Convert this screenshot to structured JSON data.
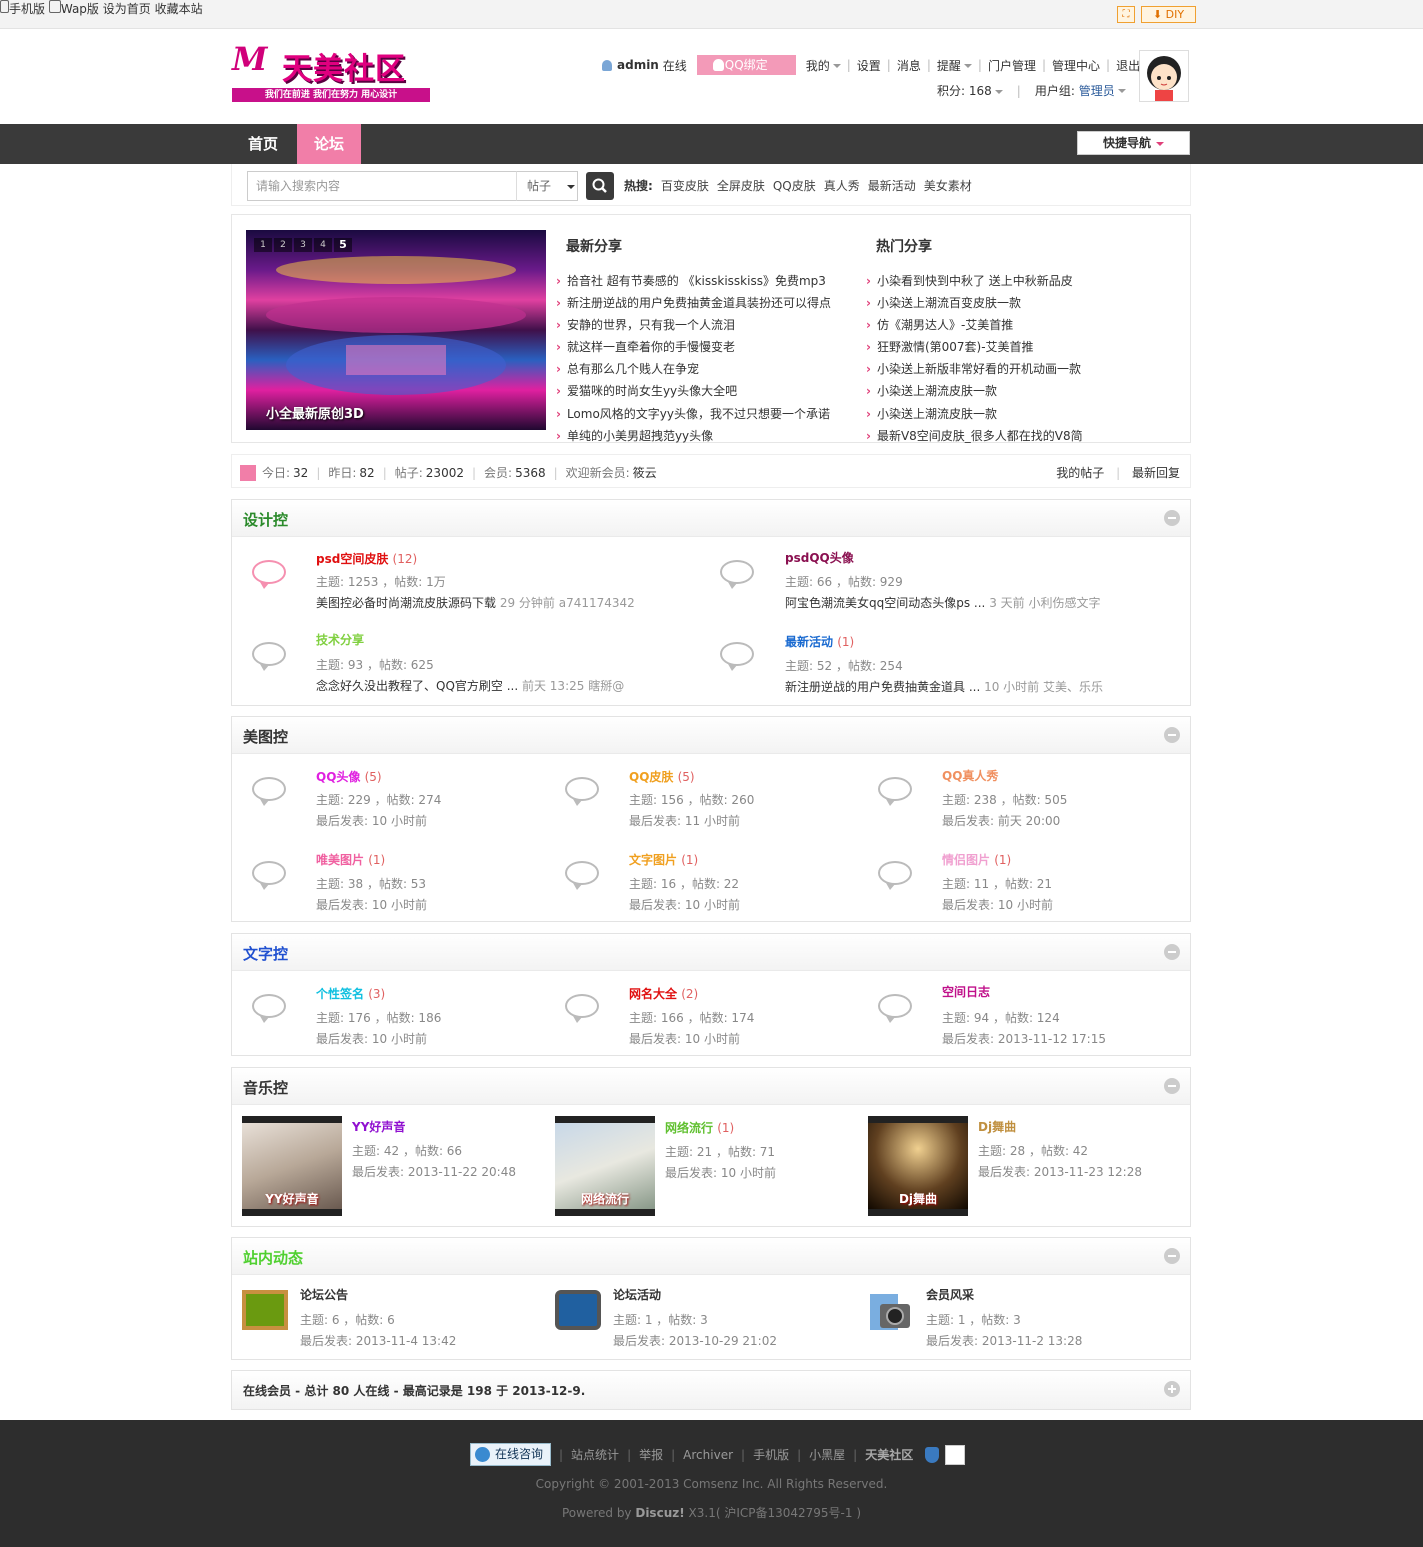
{
  "topbar": {
    "mobile": "手机版",
    "wap": "Wap版",
    "set_home": "设为首页",
    "bookmark": "收藏本站",
    "diy": "DIY"
  },
  "logo": {
    "name": "天美社区",
    "slogan": "我们在前进 我们在努力 用心设计"
  },
  "user": {
    "name": "admin",
    "status": "在线",
    "qq_bind": "QQ绑定",
    "my": "我的",
    "settings": "设置",
    "messages": "消息",
    "remind": "提醒",
    "portal": "门户管理",
    "admin_center": "管理中心",
    "logout": "退出",
    "points_label": "积分: 168",
    "group_label": "用户组:",
    "group": "管理员"
  },
  "nav": {
    "home": "首页",
    "forum": "论坛",
    "quick": "快捷导航"
  },
  "search": {
    "placeholder": "请输入搜索内容",
    "type": "帖子",
    "hot_label": "热搜:",
    "hot": [
      "百变皮肤",
      "全屏皮肤",
      "QQ皮肤",
      "真人秀",
      "最新活动",
      "美女素材"
    ]
  },
  "slide": {
    "nums": [
      "1",
      "2",
      "3",
      "4",
      "5"
    ],
    "caption": "小全最新原创3D"
  },
  "latest": {
    "title": "最新分享",
    "items": [
      "拾音社 超有节奏感的 《kisskisskiss》免费mp3",
      "新注册逆战的用户免费抽黄金道具装扮还可以得点",
      "安静的世界，只有我一个人流泪",
      "就这样一直牵着你的手慢慢变老",
      "总有那么几个贱人在争宠",
      "爱猫咪的时尚女生yy头像大全吧",
      "Lomo风格的文字yy头像，我不过只想要一个承诺",
      "单纯的小美男超拽范yy头像"
    ]
  },
  "hotshare": {
    "title": "热门分享",
    "items": [
      "小染看到快到中秋了 送上中秋新品皮",
      "小染送上潮流百变皮肤一款",
      "仿《潮男达人》-艾美首推",
      "狂野激情(第007套)-艾美首推",
      "小染送上新版非常好看的开机动画一款",
      "小染送上潮流皮肤一款",
      "小染送上潮流皮肤一款",
      "最新V8空间皮肤_很多人都在找的V8简"
    ]
  },
  "stats": {
    "today_l": "今日:",
    "today": "32",
    "yest_l": "昨日:",
    "yest": "82",
    "posts_l": "帖子:",
    "posts": "23002",
    "members_l": "会员:",
    "members": "5368",
    "welcome_l": "欢迎新会员:",
    "welcome": "筱云",
    "my_posts": "我的帖子",
    "latest_reply": "最新回复"
  },
  "sections": {
    "design": {
      "title": "设计控",
      "forums": [
        {
          "name": "psd空间皮肤",
          "count": "(12)",
          "meta": "主题: 1253 ，帖数: 1万",
          "last": "美图控必备时尚潮流皮肤源码下载",
          "when": "29 分钟前 a741174342"
        },
        {
          "name": "psdQQ头像",
          "count": "",
          "meta": "主题: 66 ，帖数: 929",
          "last": "阿宝色潮流美女qq空间动态头像ps ...",
          "when": "3 天前 小利伤感文字"
        },
        {
          "name": "技术分享",
          "count": "",
          "meta": "主题: 93 ，帖数: 625",
          "last": "念念好久没出教程了、QQ官方刷空 ...",
          "when": "前天 13:25 瞎掰@"
        },
        {
          "name": "最新活动",
          "count": "(1)",
          "meta": "主题: 52 ，帖数: 254",
          "last": "新注册逆战的用户免费抽黄金道具 ...",
          "when": "10 小时前 艾美、乐乐"
        }
      ]
    },
    "pic": {
      "title": "美图控",
      "forums": [
        {
          "name": "QQ头像",
          "count": "(5)",
          "meta": "主题: 229 ，帖数: 274",
          "last": "最后发表: 10 小时前"
        },
        {
          "name": "QQ皮肤",
          "count": "(5)",
          "meta": "主题: 156 ，帖数: 260",
          "last": "最后发表: 11 小时前"
        },
        {
          "name": "QQ真人秀",
          "count": "",
          "meta": "主题: 238 ，帖数: 505",
          "last": "最后发表: 前天 20:00"
        },
        {
          "name": "唯美图片",
          "count": "(1)",
          "meta": "主题: 38 ，帖数: 53",
          "last": "最后发表: 10 小时前"
        },
        {
          "name": "文字图片",
          "count": "(1)",
          "meta": "主题: 16 ，帖数: 22",
          "last": "最后发表: 10 小时前"
        },
        {
          "name": "情侣图片",
          "count": "(1)",
          "meta": "主题: 11 ，帖数: 21",
          "last": "最后发表: 10 小时前"
        }
      ]
    },
    "text": {
      "title": "文字控",
      "forums": [
        {
          "name": "个性签名",
          "count": "(3)",
          "meta": "主题: 176 ，帖数: 186",
          "last": "最后发表: 10 小时前"
        },
        {
          "name": "网名大全",
          "count": "(2)",
          "meta": "主题: 166 ，帖数: 174",
          "last": "最后发表: 10 小时前"
        },
        {
          "name": "空间日志",
          "count": "",
          "meta": "主题: 94 ，帖数: 124",
          "last": "最后发表: 2013-11-12 17:15"
        }
      ]
    },
    "music": {
      "title": "音乐控",
      "forums": [
        {
          "name": "YY好声音",
          "count": "",
          "meta": "主题: 42 ，帖数: 66",
          "last": "最后发表: 2013-11-22 20:48",
          "thumb": "YY好声音"
        },
        {
          "name": "网络流行",
          "count": "(1)",
          "meta": "主题: 21 ，帖数: 71",
          "last": "最后发表: 10 小时前",
          "thumb": "网络流行"
        },
        {
          "name": "Dj舞曲",
          "count": "",
          "meta": "主题: 28 ，帖数: 42",
          "last": "最后发表: 2013-11-23 12:28",
          "thumb": "Dj舞曲"
        }
      ]
    },
    "site": {
      "title": "站内动态",
      "forums": [
        {
          "name": "论坛公告",
          "meta": "主题: 6 ，帖数: 6",
          "last": "最后发表: 2013-11-4 13:42"
        },
        {
          "name": "论坛活动",
          "meta": "主题: 1 ，帖数: 3",
          "last": "最后发表: 2013-10-29 21:02"
        },
        {
          "name": "会员风采",
          "meta": "主题: 1 ，帖数: 3",
          "last": "最后发表: 2013-11-2 13:28"
        }
      ]
    },
    "online": {
      "title": "在线会员 - 总计 80 人在线 - 最高记录是 198 于 2013-12-9."
    }
  },
  "footer": {
    "consult": "在线咨询",
    "links": [
      "站点统计",
      "举报",
      "Archiver",
      "手机版",
      "小黑屋"
    ],
    "site": "天美社区",
    "copyright": "Copyright © 2001-2013 Comsenz Inc.    All Rights Reserved.",
    "powered_prefix": "Powered by ",
    "powered_brand": "Discuz!",
    "powered_suffix": " X3.1( 沪ICP备13042795号-1 )"
  },
  "colors": {
    "accent": "#f17ea8",
    "nav_bg": "#3a3a3a",
    "footer_bg": "#2d2d2d"
  }
}
